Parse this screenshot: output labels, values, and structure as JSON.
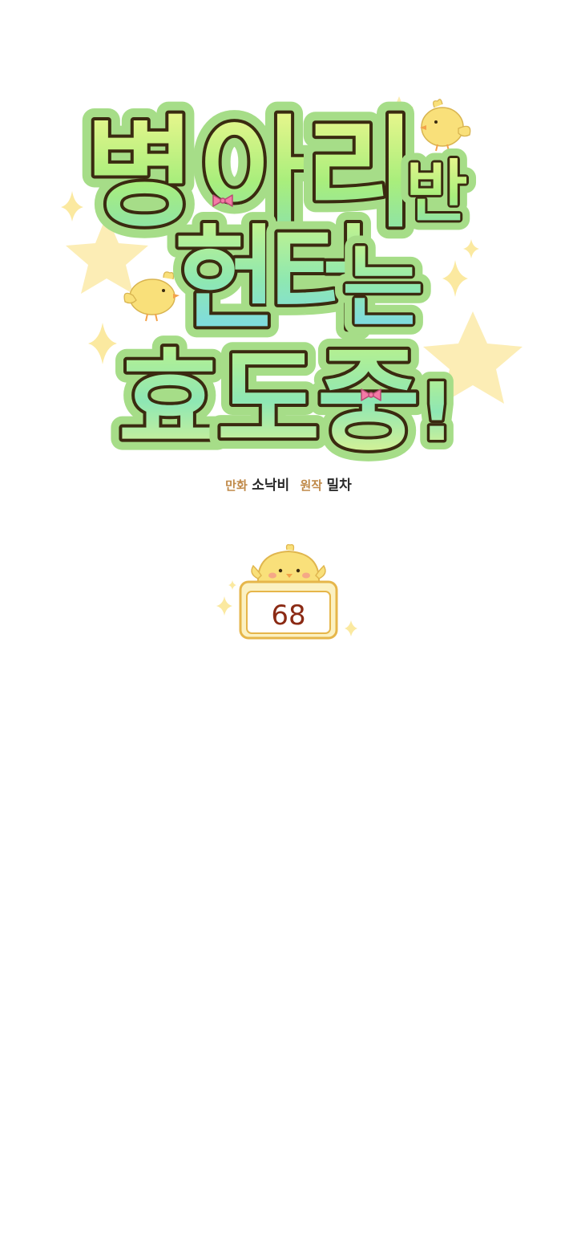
{
  "title": {
    "line1": [
      "병",
      "아",
      "리"
    ],
    "line1_small": "반",
    "line2": [
      "헌",
      "터",
      "는"
    ],
    "line3": [
      "효",
      "도",
      "중",
      "!"
    ]
  },
  "credits": {
    "art_role": "만화",
    "art_name": "소낙비",
    "story_role": "원작",
    "story_name": "밀차"
  },
  "episode": {
    "number": "68"
  },
  "colors": {
    "outline_green": "#9bd97a",
    "letter_outline": "#3a2a10",
    "gradient_top": "#e9f58a",
    "gradient_mid": "#9ef07a",
    "gradient_blue": "#7fd8f4",
    "star_yellow": "#fbeaa0",
    "chick_yellow": "#f9e07a",
    "bow_pink": "#f47aa6",
    "badge_border": "#e6b64a",
    "episode_text": "#8b2a14"
  },
  "icons": [
    "chick-icon",
    "star-icon",
    "sparkle-icon",
    "bow-icon"
  ]
}
